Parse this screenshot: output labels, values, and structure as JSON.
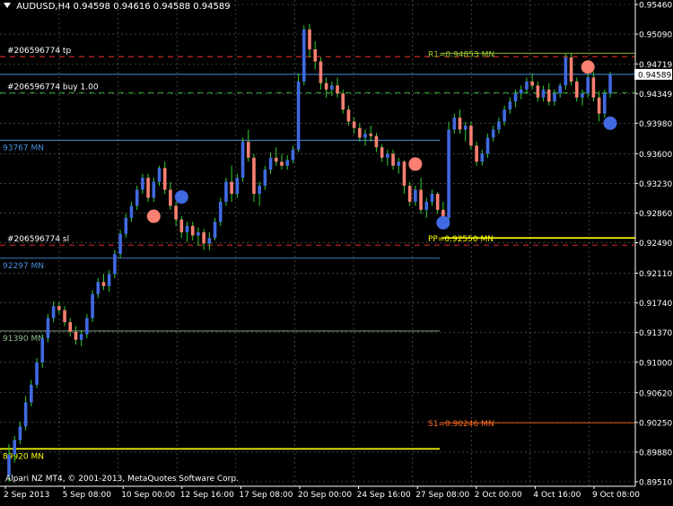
{
  "header": {
    "symbol": "AUDUSD,H4",
    "ohlc": "0.94598 0.94616 0.94588 0.94589"
  },
  "copyright": "Alpari NZ MT4, © 2001-2013, MetaQuotes Software Corp.",
  "colors": {
    "background": "#000000",
    "grid": "#c0c0c0",
    "bull": "#4169e1",
    "bear": "#fa8072",
    "wick": "#32cd32",
    "pivot": "#ffff00",
    "r1": "#9acd32",
    "s1": "#ff6c1c",
    "tp_sl": "#ff3030",
    "entry": "#32cd32",
    "blue_level": "#4a90d9",
    "green_level": "#8fbc8f",
    "price_tag": "#ffffff"
  },
  "chart_data": {
    "type": "candlestick",
    "symbol": "AUDUSD",
    "timeframe": "H4",
    "ylim": [
      0.8951,
      0.9546
    ],
    "y_ticks": [
      "0.95460",
      "0.95090",
      "0.94719",
      "0.94349",
      "0.93980",
      "0.93600",
      "0.93230",
      "0.92860",
      "0.92490",
      "0.92110",
      "0.91740",
      "0.91370",
      "0.91000",
      "0.90620",
      "0.90250",
      "0.89880",
      "0.89510"
    ],
    "x_ticks": [
      "2 Sep 2013",
      "5 Sep 08:00",
      "10 Sep 00:00",
      "12 Sep 16:00",
      "17 Sep 08:00",
      "20 Sep 00:00",
      "24 Sep 16:00",
      "27 Sep 08:00",
      "2 Oct 00:00",
      "4 Oct 16:00",
      "9 Oct 08:00"
    ],
    "current_price": "0.94589",
    "levels": [
      {
        "label": "#206596774 tp",
        "value": 0.9481,
        "style": "dash",
        "role": "tp_sl",
        "extent": "full"
      },
      {
        "label": "#206596774 buy 1.00",
        "value": 0.9436,
        "style": "dash",
        "role": "entry",
        "extent": "full"
      },
      {
        "label": "#206596774 sl",
        "value": 0.9246,
        "style": "dash",
        "role": "tp_sl",
        "extent": "full"
      },
      {
        "label": "93767 MN",
        "value": 0.93767,
        "style": "solid",
        "role": "blue_level",
        "extent": "left"
      },
      {
        "label": "92297 MN",
        "value": 0.92297,
        "style": "solid",
        "role": "blue_level",
        "extent": "left"
      },
      {
        "label": "91390 MN",
        "value": 0.9139,
        "style": "solid",
        "role": "green_level",
        "extent": "left"
      },
      {
        "label": "89920 MN",
        "value": 0.8992,
        "style": "solid",
        "role": "pivot",
        "extent": "left"
      },
      {
        "label": "R1=0.94853 MN",
        "value": 0.94853,
        "style": "solid",
        "role": "r1",
        "extent": "right"
      },
      {
        "label": "PP=0.92550 MN",
        "value": 0.9255,
        "style": "solid",
        "role": "pivot",
        "extent": "right"
      },
      {
        "label": "S1=0.90246 MN",
        "value": 0.90246,
        "style": "solid",
        "role": "s1",
        "extent": "right"
      }
    ],
    "candles": [
      [
        0.8958,
        0.8998,
        0.8951,
        0.8985
      ],
      [
        0.8985,
        0.9008,
        0.8975,
        0.9003
      ],
      [
        0.9003,
        0.9026,
        0.8998,
        0.902
      ],
      [
        0.902,
        0.9058,
        0.9015,
        0.905
      ],
      [
        0.905,
        0.9078,
        0.9045,
        0.9072
      ],
      [
        0.9072,
        0.9105,
        0.9068,
        0.91
      ],
      [
        0.91,
        0.9135,
        0.9093,
        0.913
      ],
      [
        0.913,
        0.916,
        0.9125,
        0.9155
      ],
      [
        0.9155,
        0.9176,
        0.915,
        0.917
      ],
      [
        0.917,
        0.9175,
        0.916,
        0.9165
      ],
      [
        0.9165,
        0.917,
        0.9145,
        0.915
      ],
      [
        0.915,
        0.9155,
        0.9132,
        0.9138
      ],
      [
        0.9138,
        0.9145,
        0.9122,
        0.9128
      ],
      [
        0.9128,
        0.914,
        0.912,
        0.9135
      ],
      [
        0.9135,
        0.916,
        0.913,
        0.9155
      ],
      [
        0.9155,
        0.919,
        0.915,
        0.9185
      ],
      [
        0.9185,
        0.9205,
        0.918,
        0.92
      ],
      [
        0.92,
        0.921,
        0.919,
        0.9195
      ],
      [
        0.9195,
        0.9215,
        0.9188,
        0.921
      ],
      [
        0.921,
        0.924,
        0.9205,
        0.9235
      ],
      [
        0.9235,
        0.9265,
        0.923,
        0.926
      ],
      [
        0.926,
        0.9285,
        0.9255,
        0.928
      ],
      [
        0.928,
        0.93,
        0.9275,
        0.9295
      ],
      [
        0.9295,
        0.932,
        0.929,
        0.9315
      ],
      [
        0.9315,
        0.9335,
        0.931,
        0.933
      ],
      [
        0.933,
        0.9335,
        0.93,
        0.9305
      ],
      [
        0.9305,
        0.933,
        0.93,
        0.9325
      ],
      [
        0.9325,
        0.9345,
        0.932,
        0.9342
      ],
      [
        0.9342,
        0.935,
        0.931,
        0.9315
      ],
      [
        0.9315,
        0.9325,
        0.929,
        0.9295
      ],
      [
        0.9295,
        0.93,
        0.927,
        0.9278
      ],
      [
        0.9278,
        0.9282,
        0.9255,
        0.9262
      ],
      [
        0.9262,
        0.9275,
        0.925,
        0.927
      ],
      [
        0.927,
        0.9275,
        0.9252,
        0.9258
      ],
      [
        0.9258,
        0.9268,
        0.9245,
        0.9262
      ],
      [
        0.9262,
        0.9266,
        0.924,
        0.9248
      ],
      [
        0.9248,
        0.9262,
        0.924,
        0.9255
      ],
      [
        0.9255,
        0.928,
        0.9252,
        0.9275
      ],
      [
        0.9275,
        0.9305,
        0.927,
        0.93
      ],
      [
        0.93,
        0.933,
        0.9295,
        0.9325
      ],
      [
        0.9325,
        0.9345,
        0.93,
        0.931
      ],
      [
        0.931,
        0.9335,
        0.9305,
        0.933
      ],
      [
        0.933,
        0.938,
        0.9325,
        0.9375
      ],
      [
        0.9375,
        0.939,
        0.935,
        0.9355
      ],
      [
        0.9355,
        0.936,
        0.93,
        0.931
      ],
      [
        0.931,
        0.9325,
        0.9295,
        0.932
      ],
      [
        0.932,
        0.9345,
        0.9315,
        0.934
      ],
      [
        0.934,
        0.9362,
        0.9335,
        0.9355
      ],
      [
        0.9355,
        0.9368,
        0.9345,
        0.935
      ],
      [
        0.935,
        0.936,
        0.934,
        0.9345
      ],
      [
        0.9345,
        0.9358,
        0.934,
        0.9352
      ],
      [
        0.9352,
        0.937,
        0.9348,
        0.9365
      ],
      [
        0.9365,
        0.946,
        0.9362,
        0.945
      ],
      [
        0.945,
        0.952,
        0.9445,
        0.9515
      ],
      [
        0.9515,
        0.9522,
        0.948,
        0.949
      ],
      [
        0.949,
        0.95,
        0.9465,
        0.9475
      ],
      [
        0.9475,
        0.948,
        0.944,
        0.9448
      ],
      [
        0.9448,
        0.9455,
        0.943,
        0.944
      ],
      [
        0.944,
        0.945,
        0.9432,
        0.9445
      ],
      [
        0.9445,
        0.9455,
        0.943,
        0.9435
      ],
      [
        0.9435,
        0.944,
        0.941,
        0.9415
      ],
      [
        0.9415,
        0.942,
        0.9395,
        0.94
      ],
      [
        0.94,
        0.9405,
        0.9385,
        0.9392
      ],
      [
        0.9392,
        0.9398,
        0.9375,
        0.938
      ],
      [
        0.938,
        0.939,
        0.937,
        0.9385
      ],
      [
        0.9385,
        0.9395,
        0.9375,
        0.9382
      ],
      [
        0.9382,
        0.9386,
        0.9362,
        0.9368
      ],
      [
        0.9368,
        0.9372,
        0.935,
        0.9355
      ],
      [
        0.9355,
        0.9365,
        0.9345,
        0.936
      ],
      [
        0.936,
        0.9365,
        0.934,
        0.9345
      ],
      [
        0.9345,
        0.9355,
        0.9335,
        0.935
      ],
      [
        0.935,
        0.9352,
        0.931,
        0.932
      ],
      [
        0.932,
        0.9325,
        0.9295,
        0.93
      ],
      [
        0.93,
        0.932,
        0.9295,
        0.9315
      ],
      [
        0.9315,
        0.933,
        0.9285,
        0.929
      ],
      [
        0.929,
        0.9305,
        0.928,
        0.93
      ],
      [
        0.93,
        0.9315,
        0.9295,
        0.931
      ],
      [
        0.931,
        0.9312,
        0.9285,
        0.929
      ],
      [
        0.929,
        0.93,
        0.9275,
        0.928
      ],
      [
        0.928,
        0.94,
        0.9278,
        0.939
      ],
      [
        0.939,
        0.941,
        0.9385,
        0.9405
      ],
      [
        0.9405,
        0.9415,
        0.9385,
        0.939
      ],
      [
        0.939,
        0.94,
        0.9375,
        0.9395
      ],
      [
        0.9395,
        0.94,
        0.9365,
        0.937
      ],
      [
        0.937,
        0.9375,
        0.9345,
        0.935
      ],
      [
        0.935,
        0.9365,
        0.9345,
        0.936
      ],
      [
        0.936,
        0.9385,
        0.9355,
        0.938
      ],
      [
        0.938,
        0.9395,
        0.9375,
        0.939
      ],
      [
        0.939,
        0.9405,
        0.9385,
        0.94
      ],
      [
        0.94,
        0.942,
        0.9395,
        0.9415
      ],
      [
        0.9415,
        0.943,
        0.941,
        0.9425
      ],
      [
        0.9425,
        0.944,
        0.9418,
        0.9435
      ],
      [
        0.9435,
        0.9445,
        0.9428,
        0.944
      ],
      [
        0.944,
        0.9455,
        0.9435,
        0.945
      ],
      [
        0.945,
        0.946,
        0.944,
        0.9445
      ],
      [
        0.9445,
        0.945,
        0.9425,
        0.943
      ],
      [
        0.943,
        0.9445,
        0.9425,
        0.944
      ],
      [
        0.944,
        0.9448,
        0.942,
        0.9425
      ],
      [
        0.9425,
        0.944,
        0.942,
        0.9435
      ],
      [
        0.9435,
        0.9448,
        0.943,
        0.9445
      ],
      [
        0.9445,
        0.9485,
        0.944,
        0.948
      ],
      [
        0.948,
        0.9485,
        0.9445,
        0.945
      ],
      [
        0.945,
        0.9455,
        0.9425,
        0.943
      ],
      [
        0.943,
        0.944,
        0.942,
        0.9435
      ],
      [
        0.9435,
        0.946,
        0.943,
        0.9455
      ],
      [
        0.9455,
        0.9462,
        0.9425,
        0.943
      ],
      [
        0.943,
        0.9438,
        0.94,
        0.941
      ],
      [
        0.941,
        0.944,
        0.9405,
        0.9435
      ],
      [
        0.9435,
        0.9462,
        0.943,
        0.9459
      ]
    ],
    "signals": [
      {
        "index": 26,
        "type": "sell",
        "value": 0.9282
      },
      {
        "index": 31,
        "type": "buy",
        "value": 0.9306
      },
      {
        "index": 73,
        "type": "sell",
        "value": 0.9347
      },
      {
        "index": 78,
        "type": "buy",
        "value": 0.9274
      },
      {
        "index": 104,
        "type": "sell",
        "value": 0.9468
      },
      {
        "index": 108,
        "type": "buy",
        "value": 0.9398
      }
    ]
  }
}
